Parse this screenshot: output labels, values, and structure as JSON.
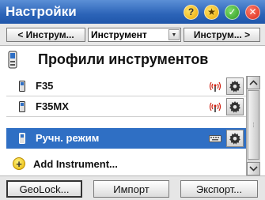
{
  "titlebar": {
    "title": "Настройки",
    "icons": [
      "help-icon",
      "favorites-star-icon",
      "ok-icon",
      "close-icon"
    ],
    "help_glyph": "?",
    "star_glyph": "★",
    "ok_glyph": "✓",
    "close_glyph": "✕"
  },
  "toolbar": {
    "prev_label": "< Инструм...",
    "combo_value": "Инструмент",
    "next_label": "Инструм... >"
  },
  "header": {
    "title": "Профили инструментов"
  },
  "list": {
    "items": [
      {
        "label": "F35",
        "status_icon": "radio-antenna-icon",
        "selected": false
      },
      {
        "label": "F35MX",
        "status_icon": "radio-antenna-icon",
        "selected": false
      },
      {
        "label": "Ручн. режим",
        "status_icon": "keyboard-icon",
        "selected": true
      }
    ],
    "add_label": "Add Instrument..."
  },
  "buttons": {
    "geolock": "GeoLock...",
    "import": "Импорт",
    "export": "Экспорт..."
  },
  "colors": {
    "titlebar": "#2c64b8",
    "selection": "#2f6fc4"
  }
}
